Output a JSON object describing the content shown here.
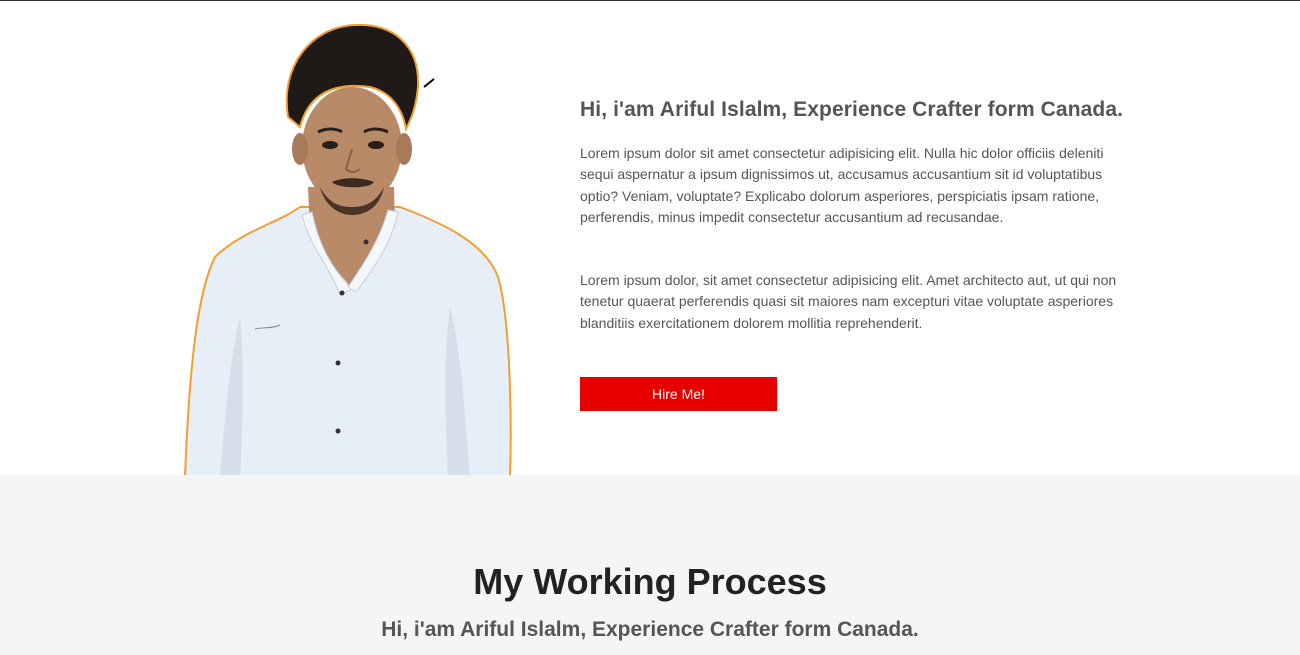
{
  "about": {
    "title": "Hi, i'am Ariful Islalm, Experience Crafter form Canada.",
    "paragraph_1": "Lorem ipsum dolor sit amet consectetur adipisicing elit. Nulla hic dolor officiis deleniti sequi aspernatur a ipsum dignissimos ut, accusamus accusantium sit id voluptatibus optio? Veniam, voluptate? Explicabo dolorum asperiores, perspiciatis ipsam ratione, perferendis, minus impedit consectetur accusantium ad recusandae.",
    "paragraph_2": "Lorem ipsum dolor, sit amet consectetur adipisicing elit. Amet architecto aut, ut qui non tenetur quaerat perferendis quasi sit maiores nam excepturi vitae voluptate asperiores blanditiis exercitationem dolorem mollitia reprehenderit.",
    "hire_button_label": "Hire Me!"
  },
  "process": {
    "title": "My Working Process",
    "subtitle": "Hi, i'am Ariful Islalm, Experience Crafter form Canada."
  },
  "colors": {
    "accent": "#e60000",
    "text": "#555555",
    "heading": "#222222",
    "section_bg": "#f5f5f5",
    "portrait_outline": "#f0a030"
  }
}
